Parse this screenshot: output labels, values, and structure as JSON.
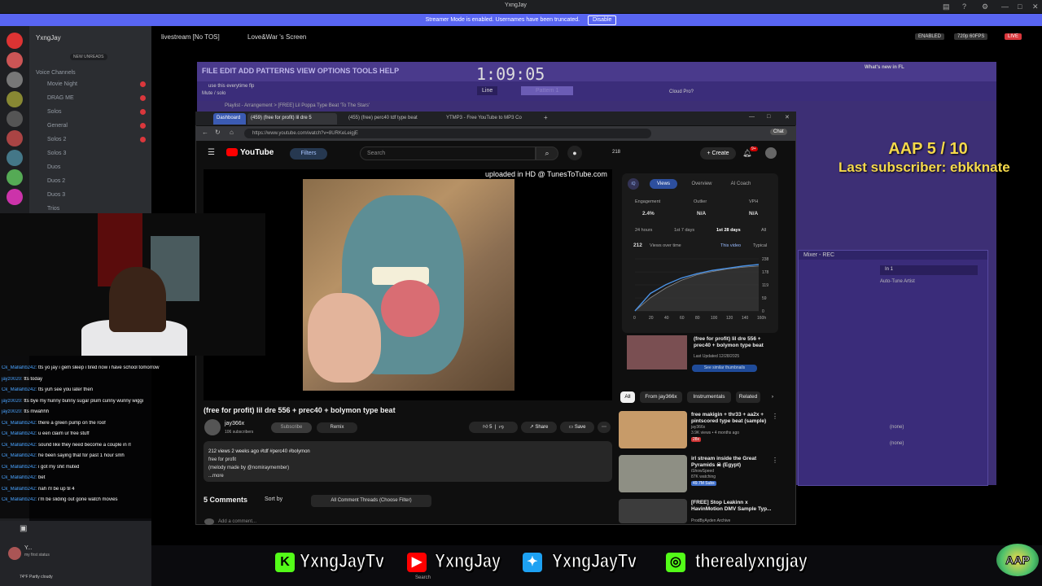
{
  "topbar": {
    "title": "YxngJay"
  },
  "notice": {
    "text": "Streamer Mode is enabled. Usernames have been truncated.",
    "disable": "Disable"
  },
  "discord": {
    "server_name": "YxngJay",
    "new_unreads": "NEW UNREADS",
    "category": "Voice Channels",
    "channels": [
      "Movie Night",
      "DRAG ME",
      "Solos",
      "General",
      "Solos 2",
      "Solos 3",
      "Duos",
      "Duos 2",
      "Duos 3",
      "Trios"
    ],
    "user": "Y...",
    "status": "my first status",
    "weather": "74°F Partly cloudy"
  },
  "stream_header": {
    "title": "livestream [No TOS]",
    "screen": "Love&War 's Screen",
    "enabled": "ENABLED",
    "quality": "720p 60FPS",
    "live": "LIVE"
  },
  "fl": {
    "menu": "FILE EDIT ADD PATTERNS VIEW OPTIONS TOOLS HELP",
    "time": "1:09:05",
    "hint1": "use this everytime flp",
    "hint2": "Mute / solo",
    "pattern": "Pattern 1",
    "line": "Line",
    "news1": "What's new in FL",
    "news2": "Cloud Pro?",
    "playlist": "Playlist - Arrangement > [FREE] Lil Poppa Type Beat 'To The Stars'",
    "mixer_title": "Mixer - REC",
    "mixer_in": "In 1",
    "mixer_fx": "Auto-Tune Artist",
    "none": "(none)"
  },
  "overlay": {
    "aap": "AAP 5 / 10",
    "last_sub": "Last subscriber: ebkknate"
  },
  "browser": {
    "tabs": [
      "Dashboard",
      "(459) (free for profit) lil dre 5",
      "(455) (free) perc40 tdf type beat",
      "YTMP3 - Free YouTube to MP3 Co"
    ],
    "url": "https://www.youtube.com/watch?v=8URKeLeigjE"
  },
  "youtube": {
    "logo": "YouTube",
    "filters": "Filters",
    "search_placeholder": "Search",
    "header_stats": "218",
    "create": "Create",
    "notif": "9+",
    "uploaded": "uploaded in HD @ TunesToTube.com",
    "video_title": "(free for profit) lil dre 556 + prec40 + bolymon type beat",
    "channel": "jay366x",
    "subscribers": "106 subscribers",
    "subscribe": "Subscribe",
    "remix": "Remix",
    "likes": "5",
    "share": "Share",
    "save": "Save",
    "desc_meta": "212 views  2 weeks ago  #tdf #perc40 #bolymon",
    "desc_line1": "free for profit",
    "desc_line2": "(melody made by @nomiraymember)",
    "desc_more": "...more",
    "comments": "5 Comments",
    "sort": "Sort by",
    "threads": "All Comment Threads (Choose Filter)",
    "add_comment": "Add a comment..."
  },
  "stats": {
    "tabs": [
      "Views",
      "Overview",
      "AI Coach"
    ],
    "labels": [
      "Engagement",
      "Outlier",
      "VPH"
    ],
    "values": [
      "2.4%",
      "N/A",
      "N/A"
    ],
    "ranges": [
      "24 hours",
      "1st 7 days",
      "1st 28 days",
      "All"
    ],
    "views": "212",
    "views_label": "Views over time",
    "legend": [
      "This video",
      "Typical"
    ],
    "y_ticks": [
      "238",
      "178",
      "119",
      "59",
      "0"
    ],
    "x_ticks": [
      "0",
      "20",
      "40",
      "60",
      "80",
      "100",
      "120",
      "140",
      "160"
    ],
    "x_suffix": "h"
  },
  "chart_data": {
    "type": "line",
    "title": "Views over time",
    "x": [
      0,
      20,
      40,
      60,
      80,
      100,
      120,
      140,
      160
    ],
    "series": [
      {
        "name": "This video",
        "values": [
          0,
          80,
          120,
          150,
          170,
          185,
          195,
          205,
          212
        ]
      },
      {
        "name": "Typical",
        "values": [
          0,
          60,
          105,
          140,
          165,
          180,
          192,
          200,
          205
        ]
      }
    ],
    "ylim": [
      0,
      238
    ],
    "grid": true,
    "legend": "top-right"
  },
  "suggest": {
    "title": "(free for profit) lil dre 556 + prec40 + bolymon type beat",
    "sub": "Last Updated 12/28/2025",
    "button": "See similar thumbnails"
  },
  "chips": [
    "All",
    "From jay366x",
    "Instrumentals",
    "Related"
  ],
  "recs": [
    {
      "title": "free makigin + thr33 + aa2x + pintscored type beat (sample)",
      "channel": "jay366x",
      "meta": "3.9K views • 4 months ago",
      "badge": "28x"
    },
    {
      "title": "irl stream inside the Great Pyramids ☠ (Egypt)",
      "channel": "iShowSpeed",
      "meta": "87K watching",
      "badge": "49.7M Subs"
    },
    {
      "title": "[FREE] Stop Leakinn x HavinMotion DMV Sample Typ...",
      "channel": "ProdByAyden Archive",
      "meta": "",
      "badge": ""
    }
  ],
  "chat": [
    "Ck_Mallahb242: tts yo jay i gem sleep i tired now i have school tomorrow",
    "jayz0020: tts today",
    "Ck_Mallahb242: tts yuh see you later then",
    "jayz0020: tts bye my hunny bunny sugar plum cunny wunny wiggi",
    "jayz0020: tts mwahhh",
    "Ck_Mallahb242: there a green pump on the roof",
    "Ck_Mallahb242: u een claim ur free stuff",
    "Ck_Mallahb242: sound like they need become a couple in rl",
    "Ck_Mallahb242: he been saying that for past 1 hour smh",
    "Ck_Mallahb242: i got my shit muted",
    "Ck_Mallahb242: bet",
    "Ck_Mallahb242: nah i'll be up til 4",
    "Ck_Mallahb242: i'm be sliding out gone watch movies"
  ],
  "social": {
    "kick": "YxngJayTv",
    "youtube": "YxngJay",
    "twitter": "YxngJayTv",
    "instagram": "therealyxngjay"
  },
  "aap_logo": "AAP",
  "taskbar_search": "Search",
  "colors": {
    "accent": "#5865f2",
    "fl_purple": "#3d2f75",
    "gold": "#f5d94b",
    "yt_red": "#ff0000",
    "kick_green": "#53fc18"
  }
}
